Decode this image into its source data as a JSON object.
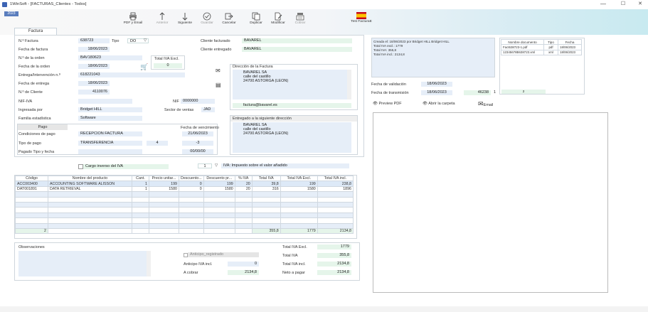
{
  "window": {
    "title": "1WinSoft - [FACTURAS_Clientes - Todos]",
    "minimize": "—",
    "maximize": "☐",
    "close": "✕"
  },
  "year_tab": "2023",
  "ribbon": {
    "pdf": "PDF y Email",
    "anterior": "Anterior",
    "siguiente": "Siguiente",
    "guardar": "Guardar",
    "cancelar": "Cancelar",
    "duplicar": "Duplicar",
    "modificar": "Modificar",
    "cobrar": "Cobrar",
    "test_facturae": "Test FacturaE"
  },
  "tab_factura": "Factura",
  "header": {
    "nfactura_label": "N.º Factura",
    "nfactura": "638723",
    "tipo_label": "Tipo",
    "tipo": "DO",
    "fecha_factura_label": "Fecha de factura",
    "fecha_factura": "18/06/2023",
    "norden_label": "N.º de la orden",
    "norden": "BAV180623",
    "fecha_orden_label": "Fecha de la orden",
    "fecha_orden": "18/06/2023",
    "total_excl_label": "Total IVA Excl.",
    "total_excl": "0",
    "entrega_label": "Entrega/Intervención n.º",
    "entrega": "618221043",
    "fecha_entrega_label": "Fecha de entrega",
    "fecha_entrega": "18/06/2023",
    "ncliente_label": "N.º de Cliente",
    "ncliente": "4110076",
    "nifiva_label": "NIF-IVA",
    "nif_label": "NIF",
    "nif": "0000000",
    "ingresada_label": "Ingresada por",
    "ingresada": "Bridget HILL",
    "sector_label": "Sector de ventas",
    "sector": "JAD",
    "familia_label": "Familia estadística",
    "familia": "Software",
    "cliente_facturado_label": "Cliente facturado",
    "cliente_facturado": "BAVAREL",
    "cliente_entregado_label": "Cliente entregado",
    "cliente_entregado": "BAVAREL"
  },
  "pago": {
    "title": "Pago",
    "vencimiento_label": "Fecha de vencimiento",
    "condiciones_label": "Condiciones de pago",
    "condiciones": "RECEPCION FACTURA",
    "vencimiento": "21/06/2023",
    "tipo_label": "Tipo de pago",
    "tipo": "TRANSFERENCIA",
    "tipo_n": "4",
    "tipo_v": "-3",
    "pagado_label": "Pagado Tipo y fecha",
    "pagado_fecha": "00/00/00"
  },
  "direccion_factura": {
    "title": "Dirección de la Factura",
    "line1": "BAVAREL SA",
    "line2": "calle del castillo",
    "line3": "24700 ASTORGA (LEON)",
    "email": "factura@bavarel.es"
  },
  "direccion_entrega": {
    "title": "Entregado a la siguiente dirección",
    "line1": "BAVAREL SA",
    "line2": "calle del castillo",
    "line3": "24700 ASTORGA (LEON)"
  },
  "info_box": {
    "line1": "Creada el: 18/06/2023 por Bridget HILL Bridget HILL",
    "line2": "Total IVA excl.: 1779",
    "line3": "Total IVA: 355,8",
    "line4": "Total IVA incl.: 2134,8"
  },
  "documents": {
    "headers": [
      "Nombre documento",
      "Tipo",
      "Fecha"
    ],
    "rows": [
      [
        "Fact638723-1.pdf",
        "pdf",
        "18/06/2023"
      ],
      [
        "12345678B638723.xml",
        "xml",
        "18/06/2023"
      ]
    ],
    "count": "2"
  },
  "validation": {
    "fecha_validacion_label": "Fecha de validación",
    "fecha_validacion": "18/06/2023",
    "fecha_transmision_label": "Fecha de transmisión",
    "fecha_transmision": "18/06/2023",
    "num": "46238",
    "flag": "1"
  },
  "links": {
    "preview": "Preview PDF",
    "carpeta": "Abrir la carpeta",
    "email": "Email"
  },
  "iva_bar": {
    "cargo": "Cargo inverso del IVA",
    "num": "1",
    "desc": "IVA: Impuesto sobre el valor añadido"
  },
  "lines": {
    "headers": [
      "Código",
      "Nombre del producto",
      "Cant.",
      "Precio unitar...",
      "Descuento...",
      "Descuento pr...",
      "% IVA",
      "Total IVA",
      "Total IVA Excl.",
      "Total IVA incl."
    ],
    "rows": [
      [
        "ACC003400",
        "ACCOUNTING SOFTWARE ALISSON",
        "1",
        "199",
        "0",
        "199",
        "20",
        "39,8",
        "199",
        "238,8"
      ],
      [
        "DAT001891",
        "DATA RETRIEVAL",
        "1",
        "1580",
        "0",
        "1580",
        "20",
        "316",
        "1580",
        "1896"
      ]
    ],
    "count": "2",
    "sum_iva": "355,8",
    "sum_excl": "1779",
    "sum_incl": "2134,8"
  },
  "obs": {
    "title": "Observaciones"
  },
  "anticipo": {
    "registrado_label": "Anticipo_registrado",
    "anticipo_label": "Anticipo IVA incl.",
    "anticipo": "0",
    "cobrar_label": "A cobrar",
    "cobrar": "2134,8"
  },
  "totals": {
    "excl_label": "Total IVA Excl.",
    "excl": "1779",
    "iva_label": "Total IVA",
    "iva": "355,8",
    "incl_label": "Total IVA incl.",
    "incl": "2134,8",
    "neto_label": "Neto a pagar",
    "neto": "2134,8"
  },
  "colors": {
    "field_blue": "#e6eef8",
    "field_green": "#e5f5ea",
    "accent": "#5a7dbd"
  }
}
